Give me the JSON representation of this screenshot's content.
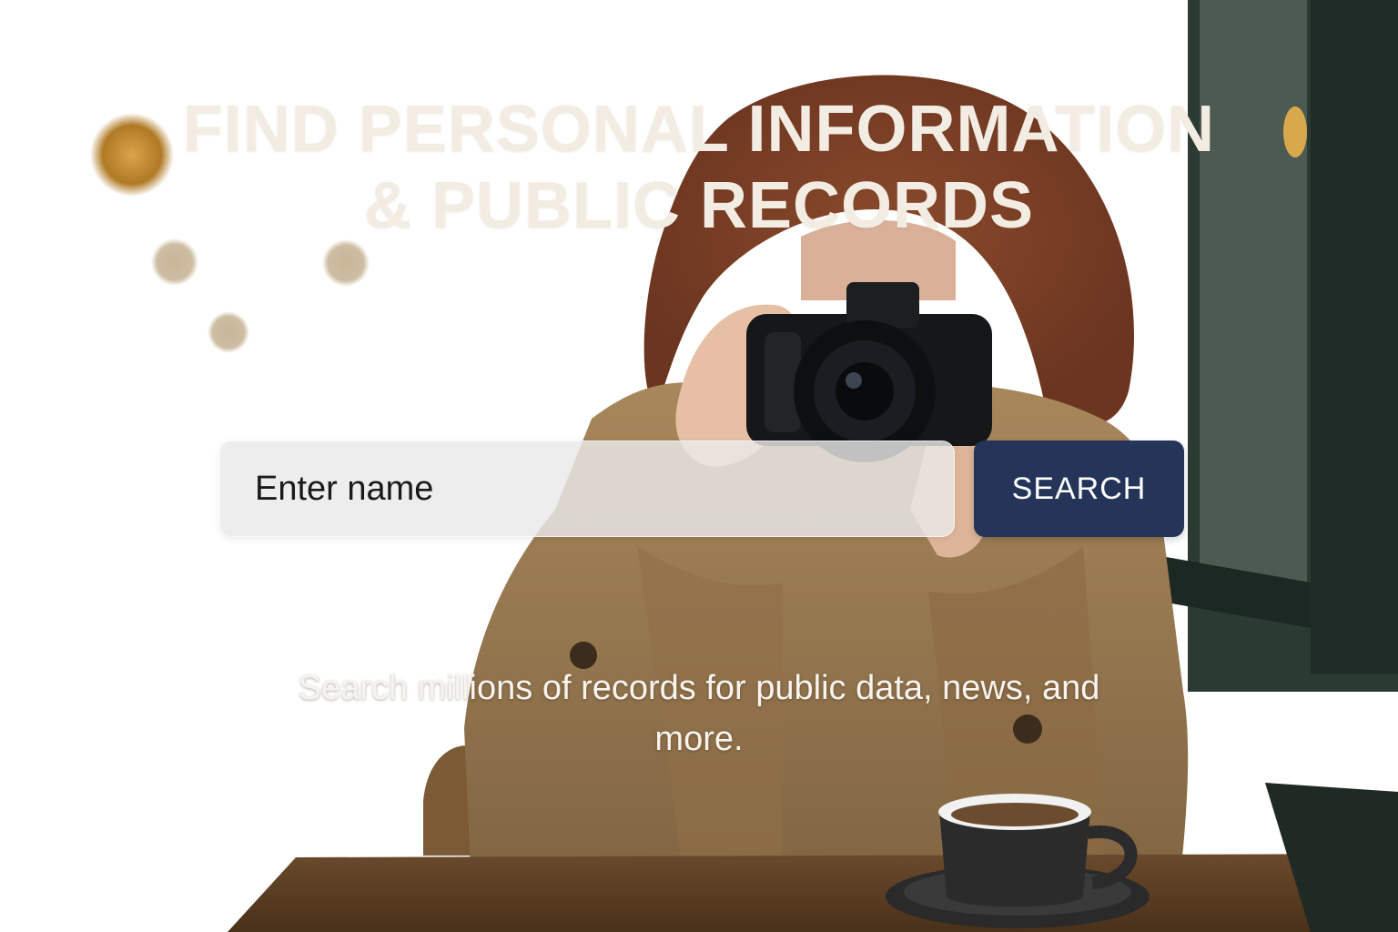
{
  "hero": {
    "headline_line1": "FIND PERSONAL INFORMATION",
    "headline_line2": "& PUBLIC RECORDS",
    "subtitle": "Search millions of records for public data, news, and more."
  },
  "search": {
    "placeholder": "Enter name",
    "value": "",
    "button_label": "SEARCH"
  },
  "colors": {
    "headline": "#f3ece3",
    "button_background": "#243559",
    "button_text": "#ffffff",
    "input_background": "#e9e9e9"
  },
  "background_photo": {
    "icon": "photographer-with-camera-photo"
  }
}
